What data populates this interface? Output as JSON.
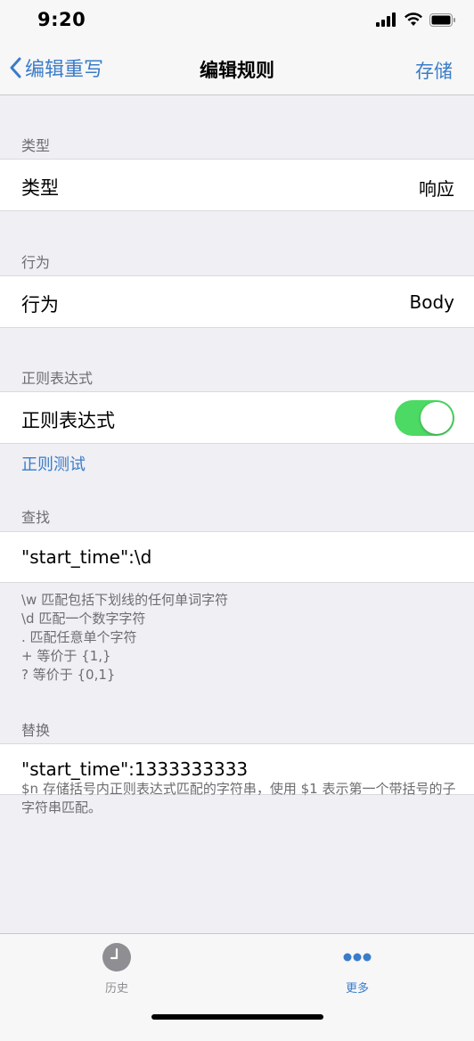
{
  "status_bar": {
    "time": "9:20"
  },
  "nav": {
    "back_label": "编辑重写",
    "title": "编辑规则",
    "save_label": "存储"
  },
  "sections": {
    "type": {
      "header": "类型",
      "label": "类型",
      "value": "响应"
    },
    "behavior": {
      "header": "行为",
      "label": "行为",
      "value": "Body"
    },
    "regex": {
      "header": "正则表达式",
      "label": "正则表达式",
      "enabled": true,
      "test_link": "正则测试"
    },
    "find": {
      "header": "查找",
      "value": "\"start_time\":\\d",
      "hints": [
        "\\w 匹配包括下划线的任何单词字符",
        "\\d 匹配一个数字字符",
        ". 匹配任意单个字符",
        "+ 等价于 {1,}",
        "? 等价于 {0,1}"
      ]
    },
    "replace": {
      "header": "替换",
      "value": "\"start_time\":1333333333",
      "note": "$n 存储括号内正则表达式匹配的字符串，使用 $1 表示第一个带括号的子字符串匹配。"
    }
  },
  "tabs": [
    {
      "label": "历史",
      "icon": "clock-icon",
      "active": false
    },
    {
      "label": "更多",
      "icon": "more-dots-icon",
      "active": true
    }
  ],
  "colors": {
    "accent": "#3b7cc9",
    "toggle_on": "#4cd964",
    "background": "#efeff4",
    "secondary_text": "#6d6d72"
  }
}
